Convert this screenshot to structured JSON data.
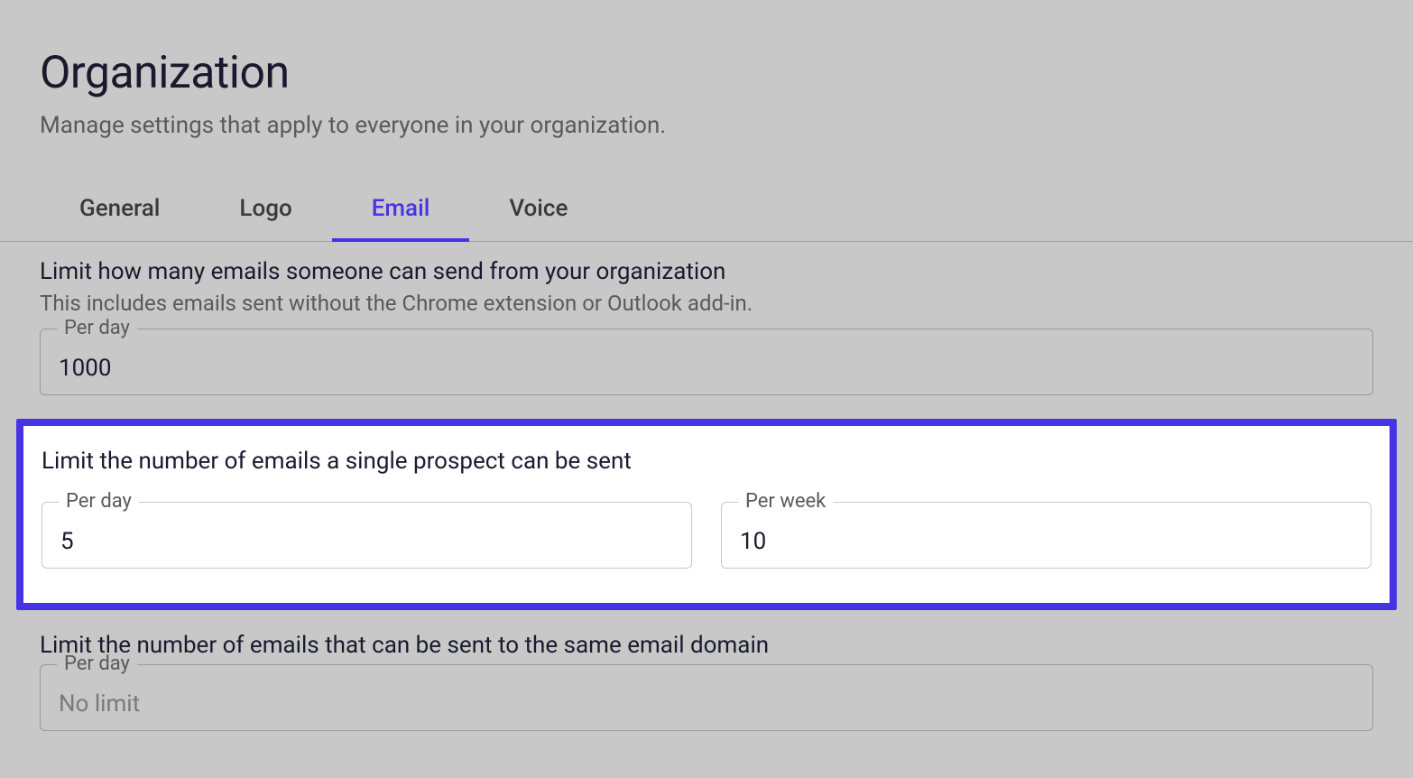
{
  "header": {
    "title": "Organization",
    "subtitle": "Manage settings that apply to everyone in your organization."
  },
  "tabs": {
    "general": "General",
    "logo": "Logo",
    "email": "Email",
    "voice": "Voice"
  },
  "section_org_limit": {
    "title": "Limit how many emails someone can send from your organization",
    "subtitle": "This includes emails sent without the Chrome extension or Outlook add-in.",
    "per_day_label": "Per day",
    "per_day_value": "1000"
  },
  "section_prospect_limit": {
    "title": "Limit the number of emails a single prospect can be sent",
    "per_day_label": "Per day",
    "per_day_value": "5",
    "per_week_label": "Per week",
    "per_week_value": "10"
  },
  "section_domain_limit": {
    "title": "Limit the number of emails that can be sent to the same email domain",
    "per_day_label": "Per day",
    "per_day_placeholder": "No limit",
    "per_day_value": ""
  }
}
